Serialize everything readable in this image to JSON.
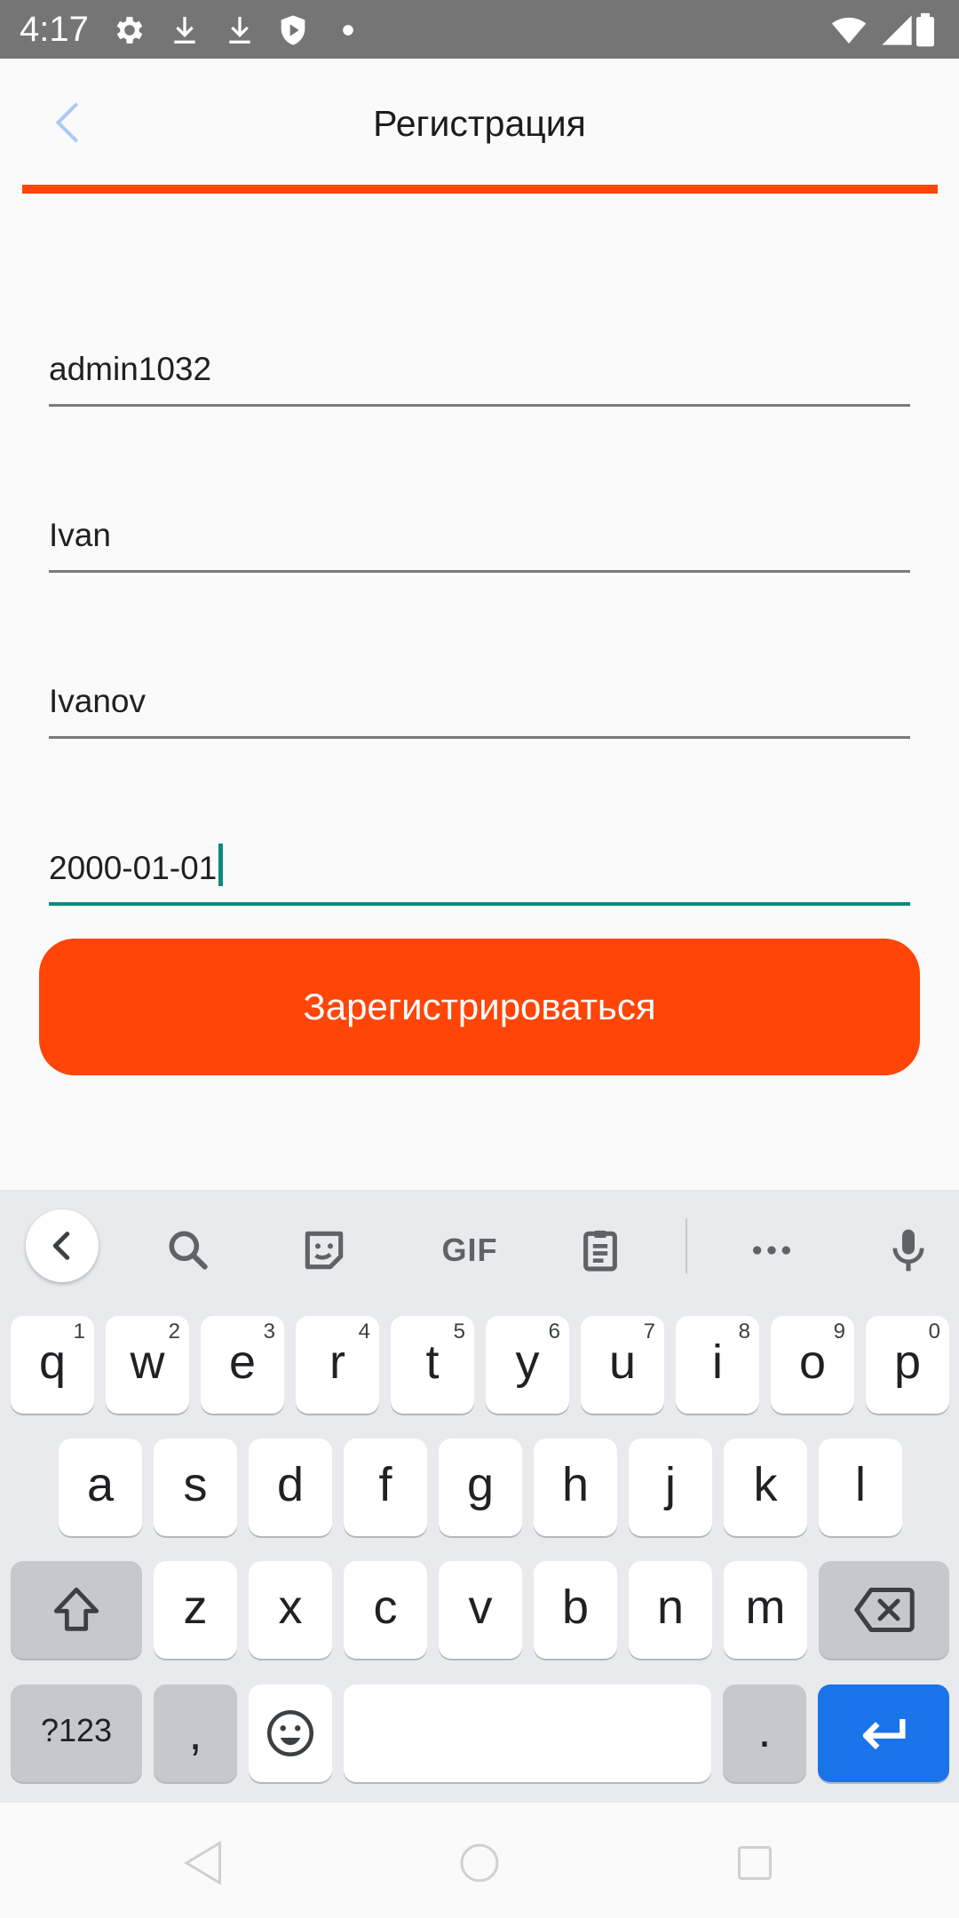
{
  "status_bar": {
    "time": "4:17",
    "left_icons": [
      "gear-icon",
      "download-icon",
      "download-icon",
      "shield-play-icon",
      "dot-icon"
    ],
    "right_icons": [
      "wifi-icon",
      "signal-icon",
      "battery-icon"
    ]
  },
  "app_bar": {
    "title": "Регистрация",
    "back_icon": "chevron-left-icon",
    "accent_color": "#ff4507"
  },
  "form": {
    "login": "admin1032",
    "first_name": "Ivan",
    "last_name": "Ivanov",
    "birth_date": "2000-01-01",
    "submit_label": "Зарегистрироваться"
  },
  "keyboard": {
    "toolbar": [
      "chevron-left-icon",
      "search-icon",
      "sticker-icon",
      "GIF",
      "clipboard-icon",
      "more-icon",
      "mic-icon"
    ],
    "row1": [
      {
        "k": "q",
        "h": "1"
      },
      {
        "k": "w",
        "h": "2"
      },
      {
        "k": "e",
        "h": "3"
      },
      {
        "k": "r",
        "h": "4"
      },
      {
        "k": "t",
        "h": "5"
      },
      {
        "k": "y",
        "h": "6"
      },
      {
        "k": "u",
        "h": "7"
      },
      {
        "k": "i",
        "h": "8"
      },
      {
        "k": "o",
        "h": "9"
      },
      {
        "k": "p",
        "h": "0"
      }
    ],
    "row2": [
      "a",
      "s",
      "d",
      "f",
      "g",
      "h",
      "j",
      "k",
      "l"
    ],
    "row3": [
      "z",
      "x",
      "c",
      "v",
      "b",
      "n",
      "m"
    ],
    "symbols_label": "?123",
    "comma": ",",
    "period": ".",
    "enter_color": "#1a73e8"
  },
  "nav_bar": {
    "icons": [
      "back-triangle-icon",
      "home-circle-icon",
      "recents-square-icon"
    ]
  }
}
